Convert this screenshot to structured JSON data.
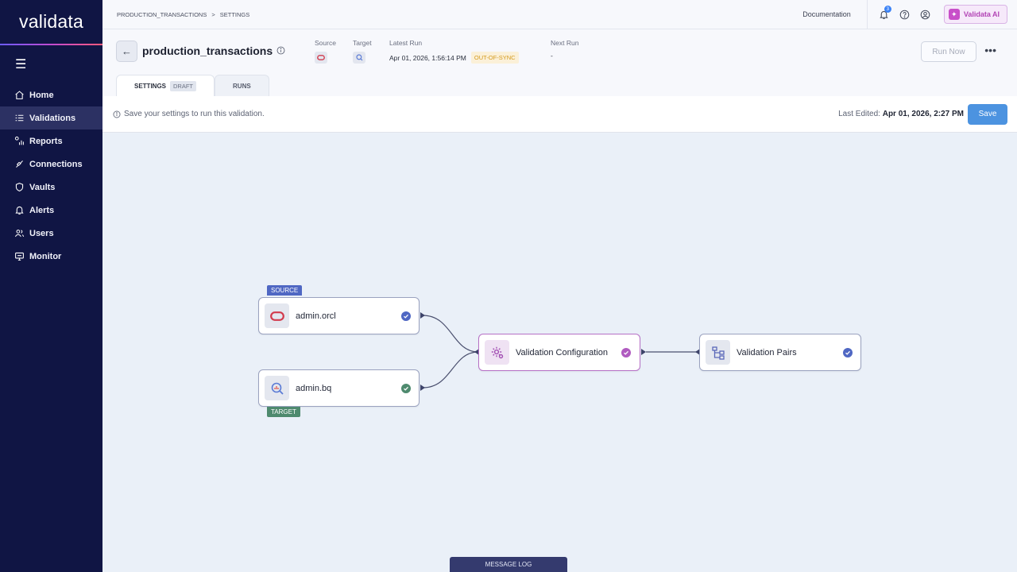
{
  "app": {
    "logo_text_a": "val",
    "logo_text_b": "idata"
  },
  "sidebar": {
    "items": [
      {
        "label": "Home",
        "icon": "home-icon"
      },
      {
        "label": "Validations",
        "icon": "checklist-icon"
      },
      {
        "label": "Reports",
        "icon": "reports-icon"
      },
      {
        "label": "Connections",
        "icon": "connections-icon"
      },
      {
        "label": "Vaults",
        "icon": "shield-icon"
      },
      {
        "label": "Alerts",
        "icon": "bell-icon"
      },
      {
        "label": "Users",
        "icon": "users-icon"
      },
      {
        "label": "Monitor",
        "icon": "monitor-icon"
      }
    ],
    "active_index": 1
  },
  "topbar": {
    "breadcrumb": [
      "PRODUCTION_TRANSACTIONS",
      "SETTINGS"
    ],
    "breadcrumb_sep": ">",
    "documentation": "Documentation",
    "notification_count": "3",
    "ai_label": "Validata AI"
  },
  "header": {
    "title": "production_transactions",
    "source_label": "Source",
    "target_label": "Target",
    "latest_run_label": "Latest Run",
    "latest_run_value": "Apr 01, 2026, 1:56:14 PM",
    "latest_run_status": "OUT-OF-SYNC",
    "next_run_label": "Next Run",
    "next_run_value": "-",
    "run_now": "Run Now",
    "more": "•••"
  },
  "tabs": [
    {
      "label": "SETTINGS",
      "badge": "DRAFT"
    },
    {
      "label": "RUNS"
    }
  ],
  "notice": {
    "message": "Save your settings to run this validation.",
    "last_edited_label": "Last Edited:",
    "last_edited_value": "Apr 01, 2026, 2:27 PM",
    "save": "Save"
  },
  "flow": {
    "source": {
      "tag": "SOURCE",
      "label": "admin.orcl"
    },
    "target": {
      "tag": "TARGET",
      "label": "admin.bq"
    },
    "config": {
      "label": "Validation Configuration"
    },
    "pairs": {
      "label": "Validation Pairs"
    }
  },
  "colors": {
    "sidebar_bg": "#101544",
    "accent_blue": "#4c93e0",
    "source_tag": "#4f67c3",
    "target_tag": "#4e8a6e",
    "config_purple": "#b670c6",
    "oracle_red": "#d23a4c"
  },
  "message_log": "MESSAGE LOG"
}
